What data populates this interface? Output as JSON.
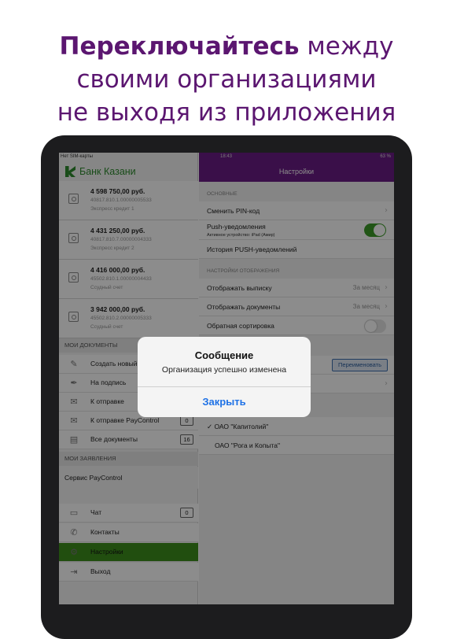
{
  "headline": {
    "bold": "Переключайтесь",
    "line1_rest": " между",
    "line2": "своими организациями",
    "line3": "не выходя из приложения"
  },
  "statusbar": {
    "carrier": "Нет SIM-карты",
    "time": "18:43",
    "battery": "63 %"
  },
  "sidebar": {
    "logo_text": "Банк Казани",
    "accounts": [
      {
        "amount": "4 598 750,00 руб.",
        "number": "40817.810.1.00000005533",
        "desc": "Экспресс кредит 1"
      },
      {
        "amount": "4 431 250,00 руб.",
        "number": "40817.810.7.00000004333",
        "desc": "Экспресс кредит 2"
      },
      {
        "amount": "4 416 000,00 руб.",
        "number": "45502.810.1.00000004433",
        "desc": "Ссудный счет"
      },
      {
        "amount": "3 942 000,00 руб.",
        "number": "45502.810.2.00000005333",
        "desc": "Ссудный счет"
      }
    ],
    "docs_header": "МОИ ДОКУМЕНТЫ",
    "docs": [
      {
        "label": "Создать новый",
        "icon": "pencil-icon",
        "glyph": "✎"
      },
      {
        "label": "На подпись",
        "icon": "pen-nib-icon",
        "glyph": "✒"
      },
      {
        "label": "К отправке",
        "icon": "envelope-icon",
        "glyph": "✉"
      },
      {
        "label": "К отправке PayControl",
        "icon": "envelope-icon",
        "glyph": "✉",
        "badge": "0"
      },
      {
        "label": "Все документы",
        "icon": "document-icon",
        "glyph": "▤",
        "badge": "16"
      }
    ],
    "apps_header": "МОИ ЗАЯВЛЕНИЯ",
    "apps_item": "Сервис PayControl",
    "bottom": [
      {
        "label": "Чат",
        "icon": "chat-icon",
        "glyph": "▭",
        "badge": "0"
      },
      {
        "label": "Контакты",
        "icon": "phone-icon",
        "glyph": "✆"
      },
      {
        "label": "Настройки",
        "icon": "gear-icon",
        "glyph": "⚙",
        "active": true
      },
      {
        "label": "Выход",
        "icon": "exit-icon",
        "glyph": "⇥"
      }
    ]
  },
  "settings": {
    "title": "Настройки",
    "group_main": "ОСНОВНЫЕ",
    "change_pin": "Сменить PIN-код",
    "push_label": "Push-уведомления",
    "push_sub": "Активное устройство: iPad (Амир)",
    "push_history": "История PUSH-уведомлений",
    "group_display": "НАСТРОЙКИ ОТОБРАЖЕНИЯ",
    "show_statement": "Отображать выписку",
    "show_statement_value": "За месяц",
    "show_docs": "Отображать документы",
    "show_docs_value": "За месяц",
    "reverse_sort": "Обратная сортировка",
    "rename_button": "Переименовать",
    "orgs": [
      {
        "label": "✓  ОАО \"Капитолий\""
      },
      {
        "label": "ОАО \"Рога и Копыта\""
      }
    ]
  },
  "alert": {
    "title": "Сообщение",
    "message": "Организация успешно изменена",
    "button": "Закрыть"
  }
}
